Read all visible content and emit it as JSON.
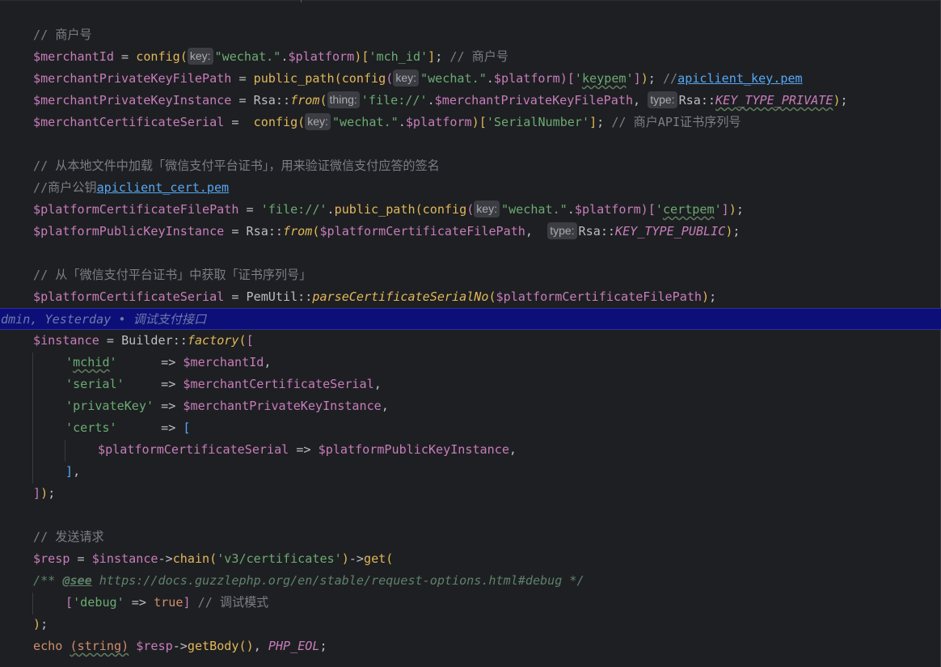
{
  "editor": {
    "language": "PHP",
    "lines": {
      "l1": {
        "comment": "// 商户号"
      },
      "l2": {
        "var": "$merchantId",
        "op": " = ",
        "fn": "config",
        "open": "(",
        "hint": "key:",
        "str": "\"wechat.\"",
        "dot": ".",
        "var2": "$platform",
        "close": ")",
        "idx_open": "[",
        "key": "'mch_id'",
        "idx_close": "]",
        "semi": ";",
        "comment": " // 商户号"
      },
      "l3": {
        "var": "$merchantPrivateKeyFilePath",
        "op": " = ",
        "fn": "public_path",
        "open": "(",
        "fn2": "config",
        "open2": "(",
        "hint": "key:",
        "str": "\"wechat.\"",
        "dot": ".",
        "var2": "$platform",
        "close2": ")",
        "idx_open": "[",
        "key_q1": "'",
        "key": "keypem",
        "key_q2": "'",
        "idx_close": "]",
        "close": ")",
        "semi": ";",
        "comment_prefix": " //",
        "comment_link": "apiclient_key.pem"
      },
      "l4": {
        "var": "$merchantPrivateKeyInstance",
        "op": " = ",
        "cls": "Rsa",
        "scope": "::",
        "fn": "from",
        "open": "(",
        "hint1": "thing:",
        "str": "'file://'",
        "dot": ".",
        "var2": "$merchantPrivateKeyFilePath",
        "comma": ",",
        "hint2": "type:",
        "cls2": "Rsa",
        "scope2": "::",
        "const": "KEY_TYPE_PRIVATE",
        "close": ")",
        "semi": ";"
      },
      "l5": {
        "var": "$merchantCertificateSerial",
        "op": " =  ",
        "fn": "config",
        "open": "(",
        "hint": "key:",
        "str": "\"wechat.\"",
        "dot": ".",
        "var2": "$platform",
        "close": ")",
        "idx_open": "[",
        "key": "'SerialNumber'",
        "idx_close": "]",
        "semi": ";",
        "comment": " // 商户API证书序列号"
      },
      "l7": {
        "comment": "// 从本地文件中加载「微信支付平台证书」，用来验证微信支付应答的签名"
      },
      "l8": {
        "comment_prefix": "//商户公钥",
        "comment_link": "apiclient_cert.pem"
      },
      "l9": {
        "var": "$platformCertificateFilePath",
        "op": " = ",
        "str": "'file://'",
        "dot": ".",
        "fn": "public_path",
        "open": "(",
        "fn2": "config",
        "open2": "(",
        "hint": "key:",
        "str2": "\"wechat.\"",
        "dot2": ".",
        "var2": "$platform",
        "close2": ")",
        "idx_open": "[",
        "key_q1": "'",
        "key": "certpem",
        "key_q2": "'",
        "idx_close": "]",
        "close": ")",
        "semi": ";"
      },
      "l10": {
        "var": "$platformPublicKeyInstance",
        "op": " = ",
        "cls": "Rsa",
        "scope": "::",
        "fn": "from",
        "open": "(",
        "var2": "$platformCertificateFilePath",
        "comma": ",",
        "hint": "type:",
        "cls2": "Rsa",
        "scope2": "::",
        "const": "KEY_TYPE_PUBLIC",
        "close": ")",
        "semi": ";"
      },
      "l12": {
        "comment": "// 从「微信支付平台证书」中获取「证书序列号」"
      },
      "l13": {
        "var": "$platformCertificateSerial",
        "op": " = ",
        "cls": "PemUtil",
        "scope": "::",
        "fn": "parseCertificateSerialNo",
        "open": "(",
        "var2": "$platformCertificateFilePath",
        "close": ")",
        "semi": ";"
      },
      "l14_blame": "dmin, Yesterday • 调试支付接口",
      "l15": {
        "var": "$instance",
        "op": " = ",
        "cls": "Builder",
        "scope": "::",
        "fn": "factory",
        "open": "(",
        "arr": "["
      },
      "l16": {
        "q1": "'",
        "key": "mchid",
        "q2": "'",
        "arrow": "      => ",
        "var": "$merchantId",
        "comma": ","
      },
      "l17": {
        "key": "'serial'",
        "arrow": "     => ",
        "var": "$merchantCertificateSerial",
        "comma": ","
      },
      "l18": {
        "key": "'privateKey'",
        "arrow": " => ",
        "var": "$merchantPrivateKeyInstance",
        "comma": ","
      },
      "l19": {
        "key": "'certs'",
        "arrow": "      => ",
        "arr": "["
      },
      "l20": {
        "var": "$platformCertificateSerial",
        "arrow": " => ",
        "var2": "$platformPublicKeyInstance",
        "comma": ","
      },
      "l21": {
        "arr": "]",
        "comma": ","
      },
      "l22": {
        "arr": "]",
        "close": ")",
        "semi": ";"
      },
      "l24": {
        "comment": "// 发送请求"
      },
      "l25": {
        "var": "$resp",
        "op": " = ",
        "var2": "$instance",
        "arrow": "->",
        "fn": "chain",
        "open": "(",
        "str": "'v3/certificates'",
        "close": ")",
        "arrow2": "->",
        "fn2": "get",
        "open2": "("
      },
      "l26": {
        "doc_open": "/** ",
        "tag": "@see",
        "url": " https://docs.guzzlephp.org/en/stable/request-options.html#debug */"
      },
      "l27": {
        "arr_open": "[",
        "key": "'debug'",
        "arrow": " => ",
        "kw": "true",
        "arr_close": "]",
        "comment": " // 调试模式"
      },
      "l28": {
        "close": ")",
        "semi": ";"
      },
      "l29": {
        "kw": "echo",
        "sp": " ",
        "cast": "(string)",
        "sp2": " ",
        "var": "$resp",
        "arrow": "->",
        "fn": "getBody",
        "call": "()",
        "comma": ", ",
        "const": "PHP_EOL",
        "semi": ";"
      }
    }
  }
}
